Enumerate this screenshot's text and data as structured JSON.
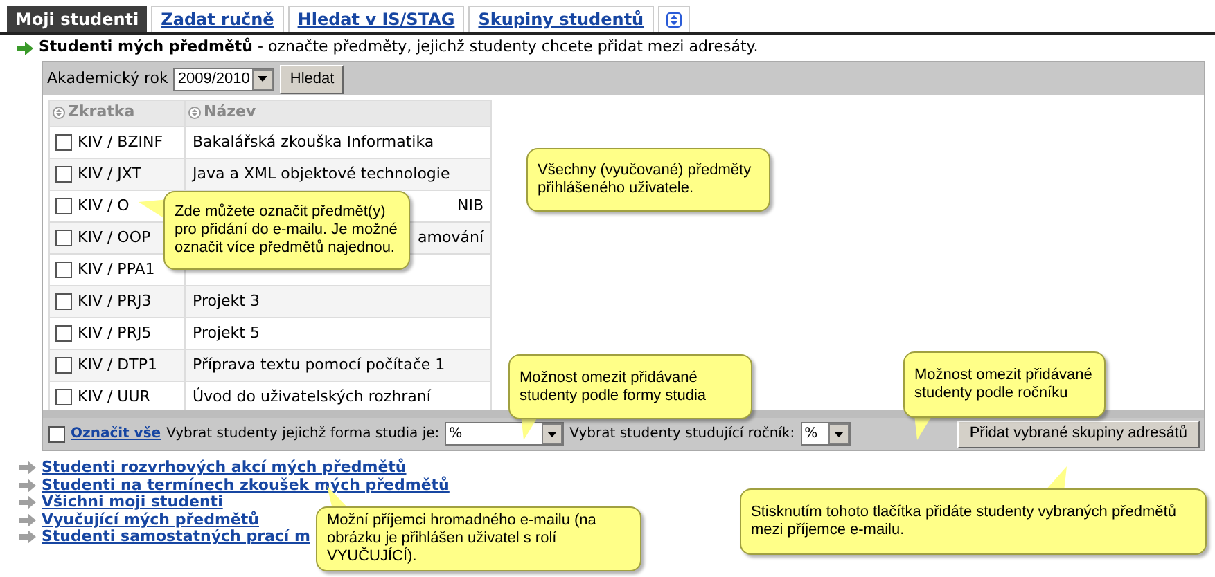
{
  "tabs": [
    {
      "label": "Moji studenti",
      "selected": true
    },
    {
      "label": "Zadat ručně",
      "selected": false
    },
    {
      "label": "Hledat v IS/STAG",
      "selected": false
    },
    {
      "label": "Skupiny studentů",
      "selected": false
    }
  ],
  "heading": {
    "title": "Studenti mých předmětů",
    "description": "- označte předměty, jejichž studenty chcete přidat mezi adresáty."
  },
  "toolbar": {
    "year_label": "Akademický rok",
    "year_value": "2009/2010",
    "search_button": "Hledat"
  },
  "table": {
    "columns": [
      "Zkratka",
      "Název"
    ],
    "rows": [
      {
        "code": "KIV / BZINF",
        "name": "Bakalářská zkouška Informatika",
        "checked": false
      },
      {
        "code": "KIV / JXT",
        "name": "Java a XML objektové technologie",
        "checked": false
      },
      {
        "code": "KIV / O",
        "name_tail": "NIB",
        "checked": false
      },
      {
        "code": "KIV / OOP",
        "name_tail": "amování",
        "checked": false
      },
      {
        "code": "KIV / PPA1",
        "checked": false
      },
      {
        "code": "KIV / PRJ3",
        "name": "Projekt 3",
        "checked": false
      },
      {
        "code": "KIV / PRJ5",
        "name": "Projekt 5",
        "checked": false
      },
      {
        "code": "KIV / DTP1",
        "name": "Příprava textu pomocí počítače 1",
        "checked": false
      },
      {
        "code": "KIV / UUR",
        "name": "Úvod do uživatelských rozhraní",
        "checked": false
      }
    ]
  },
  "filter_bar": {
    "select_all_checked": false,
    "select_all": "Označit vše",
    "form_label": "Vybrat studenty jejichž forma studia je:",
    "form_value": "%",
    "year_label": "Vybrat studenty studující ročník:",
    "year_value": "%",
    "add_button": "Přidat vybrané skupiny adresátů"
  },
  "links": [
    "Studenti rozvrhových akcí mých předmětů",
    "Studenti na termínech zkoušek mých předmětů",
    "Všichni moji studenti",
    "Vyučující mých předmětů",
    "Studenti samostatných prací m"
  ],
  "callouts": [
    "Zde můžete označit předmět(y) pro přidání do e-mailu. Je možné označit více předmětů najednou.",
    "Všechny (vyučované) předměty přihlášeného uživatele.",
    "Možnost omezit přidávané studenty podle formy studia",
    "Možnost omezit přidávané studenty podle ročníku",
    "Stisknutím tohoto tlačítka přidáte studenty vybraných předmětů mezi příjemce e-mailu.",
    "Možní příjemci hromadného e-mailu (na obrázku je přihlášen uživatel s rolí VYUČUJÍCÍ)."
  ]
}
